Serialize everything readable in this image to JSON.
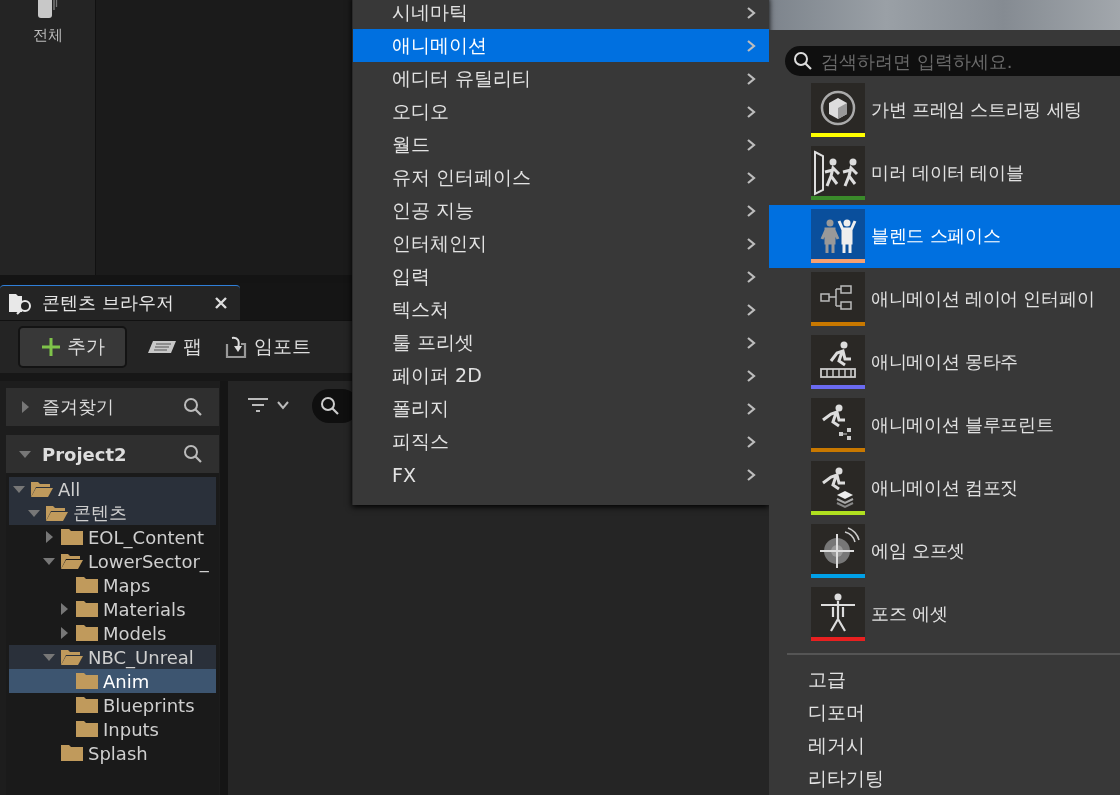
{
  "top_panel": {
    "label": "전체"
  },
  "content_browser": {
    "tab": {
      "title": "콘텐츠 브라우저",
      "selected": true
    },
    "toolbar": {
      "add": "추가",
      "fab": "팹",
      "import": "임포트"
    },
    "favorites": {
      "title": "즐겨찾기",
      "expanded": false
    },
    "project": {
      "title": "Project2",
      "expanded": true
    },
    "tree": [
      {
        "label": "All",
        "expandable": true,
        "expanded": true,
        "selected": false,
        "highlighted": true,
        "children": [
          {
            "label": "콘텐츠",
            "expandable": true,
            "expanded": true,
            "selected": false,
            "highlighted": true,
            "children": [
              {
                "label": "EOL_Content",
                "expandable": true,
                "expanded": false,
                "selected": false,
                "highlighted": false
              },
              {
                "label": "LowerSector_",
                "expandable": true,
                "expanded": true,
                "selected": false,
                "highlighted": false,
                "children": [
                  {
                    "label": "Maps",
                    "expandable": false,
                    "expanded": false,
                    "selected": false,
                    "highlighted": false
                  },
                  {
                    "label": "Materials",
                    "expandable": true,
                    "expanded": false,
                    "selected": false,
                    "highlighted": false
                  },
                  {
                    "label": "Models",
                    "expandable": true,
                    "expanded": false,
                    "selected": false,
                    "highlighted": false
                  }
                ]
              },
              {
                "label": "NBC_Unreal",
                "expandable": true,
                "expanded": true,
                "selected": false,
                "highlighted": true,
                "children": [
                  {
                    "label": "Anim",
                    "expandable": false,
                    "expanded": false,
                    "selected": true,
                    "highlighted": false
                  },
                  {
                    "label": "Blueprints",
                    "expandable": false,
                    "expanded": false,
                    "selected": false,
                    "highlighted": false
                  },
                  {
                    "label": "Inputs",
                    "expandable": false,
                    "expanded": false,
                    "selected": false,
                    "highlighted": false
                  }
                ]
              },
              {
                "label": "Splash",
                "expandable": false,
                "expanded": false,
                "selected": false,
                "highlighted": false
              }
            ]
          }
        ]
      }
    ]
  },
  "main_menu": {
    "items": [
      {
        "label": "시네마틱",
        "selected": false
      },
      {
        "label": "애니메이션",
        "selected": true
      },
      {
        "label": "에디터 유틸리티",
        "selected": false
      },
      {
        "label": "오디오",
        "selected": false
      },
      {
        "label": "월드",
        "selected": false
      },
      {
        "label": "유저 인터페이스",
        "selected": false
      },
      {
        "label": "인공 지능",
        "selected": false
      },
      {
        "label": "인터체인지",
        "selected": false
      },
      {
        "label": "입력",
        "selected": false
      },
      {
        "label": "텍스처",
        "selected": false
      },
      {
        "label": "툴 프리셋",
        "selected": false
      },
      {
        "label": "페이퍼 2D",
        "selected": false
      },
      {
        "label": "폴리지",
        "selected": false
      },
      {
        "label": "피직스",
        "selected": false
      },
      {
        "label": "FX",
        "selected": false
      }
    ]
  },
  "submenu": {
    "search": {
      "placeholder": "검색하려면 입력하세요."
    },
    "asset_items": [
      {
        "label": "가변 프레임 스트리핑 세팅",
        "color": "#ffff00",
        "selected": false
      },
      {
        "label": "미러 데이터 테이블",
        "color": "#3a8a2a",
        "selected": false
      },
      {
        "label": "블렌드 스페이스",
        "color": "#f5a070",
        "selected": true
      },
      {
        "label": "애니메이션 레이어 인터페이",
        "color": "#c87800",
        "selected": false
      },
      {
        "label": "애니메이션 몽타주",
        "color": "#6a6af0",
        "selected": false
      },
      {
        "label": "애니메이션 블루프린트",
        "color": "#c87800",
        "selected": false
      },
      {
        "label": "애니메이션 컴포짓",
        "color": "#b0e020",
        "selected": false
      },
      {
        "label": "에임 오프셋",
        "color": "#00a0e8",
        "selected": false
      },
      {
        "label": "포즈 에셋",
        "color": "#e82020",
        "selected": false
      }
    ],
    "category_items": [
      {
        "label": "고급"
      },
      {
        "label": "디포머"
      },
      {
        "label": "레거시"
      },
      {
        "label": "리타기팅"
      }
    ]
  }
}
